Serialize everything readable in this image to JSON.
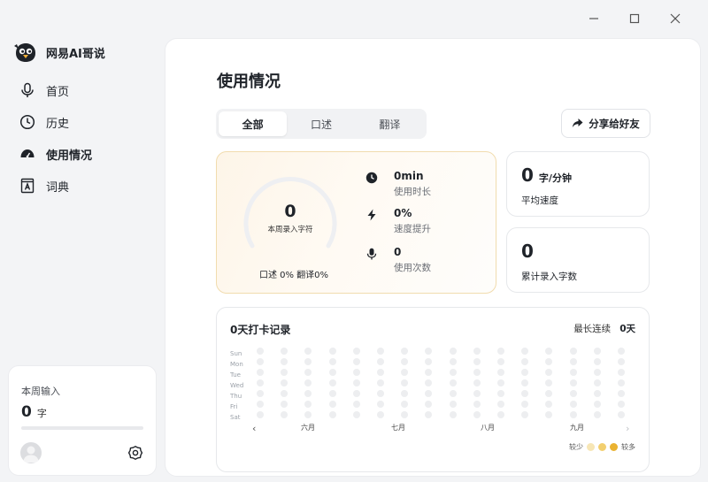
{
  "app": {
    "name": "网易AI哥说"
  },
  "nav": [
    {
      "label": "首页",
      "icon": "mic-icon"
    },
    {
      "label": "历史",
      "icon": "clock-icon"
    },
    {
      "label": "使用情况",
      "icon": "gauge-icon"
    },
    {
      "label": "词典",
      "icon": "dictionary-icon"
    }
  ],
  "week": {
    "title": "本周输入",
    "count": "0",
    "unit": "字",
    "progress": 0
  },
  "page": {
    "title": "使用情况"
  },
  "tabs": [
    "全部",
    "口述",
    "翻译"
  ],
  "share": {
    "label": "分享给好友"
  },
  "stats": {
    "gauge_value": "0",
    "gauge_label": "本周录入字符",
    "split": "口述 0%  翻译0%",
    "metrics": [
      {
        "value": "0min",
        "label": "使用时长",
        "icon": "clock-icon"
      },
      {
        "value": "0%",
        "label": "速度提升",
        "icon": "lightning-icon"
      },
      {
        "value": "0",
        "label": "使用次数",
        "icon": "mic-icon"
      }
    ]
  },
  "speed": {
    "value": "0",
    "unit": "字/分钟",
    "label": "平均速度"
  },
  "total": {
    "value": "0",
    "label": "累计录入字数"
  },
  "calendar": {
    "title": "0天打卡记录",
    "streak_label": "最长连续",
    "streak_value": "0天",
    "days": [
      "Sun",
      "Mon",
      "Tue",
      "Wed",
      "Thu",
      "Fri",
      "Sat"
    ],
    "months": [
      "六月",
      "七月",
      "八月",
      "九月"
    ],
    "legend_less": "较少",
    "legend_more": "较多",
    "legend_colors": [
      "#f7e6b5",
      "#f2cf6f",
      "#eab231"
    ],
    "empty_color": "#edeef0"
  }
}
